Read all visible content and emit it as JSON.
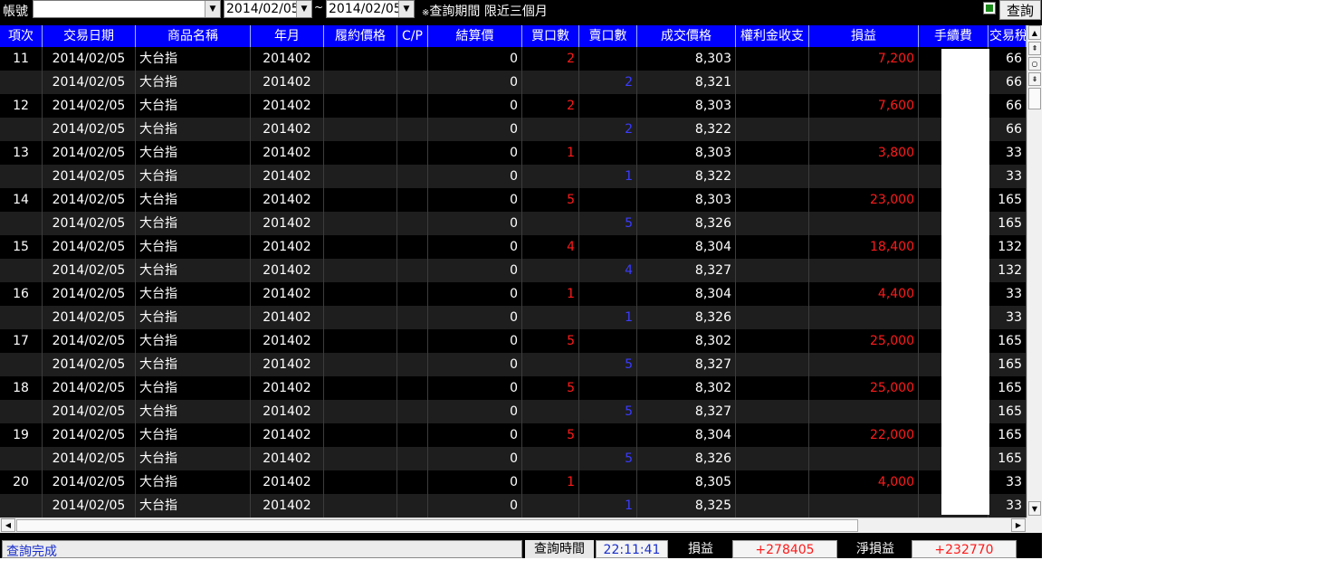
{
  "toolbar": {
    "account_label": "帳號",
    "account_value": "",
    "start_date": "2014/02/05",
    "end_date": "2014/02/05",
    "tilde": "~",
    "note_mark": "※",
    "note_text": "查詢期間 限近三個月",
    "query_label": "查詢"
  },
  "columns": [
    "項次",
    "交易日期",
    "商品名稱",
    "年月",
    "履約價格",
    "C/P",
    "結算價",
    "買口數",
    "賣口數",
    "成交價格",
    "權利金收支",
    "損益",
    "手續費",
    "交易稅"
  ],
  "rows": [
    {
      "no": "11",
      "date": "2014/02/05",
      "product": "大台指",
      "ym": "201402",
      "strike": "",
      "cp": "",
      "settle": "0",
      "buy": "2",
      "sell": "",
      "price": "8,303",
      "premium": "",
      "pnl": "7,200",
      "fee": "",
      "tax": "66"
    },
    {
      "no": "",
      "date": "2014/02/05",
      "product": "大台指",
      "ym": "201402",
      "strike": "",
      "cp": "",
      "settle": "0",
      "buy": "",
      "sell": "2",
      "price": "8,321",
      "premium": "",
      "pnl": "",
      "fee": "",
      "tax": "66"
    },
    {
      "no": "12",
      "date": "2014/02/05",
      "product": "大台指",
      "ym": "201402",
      "strike": "",
      "cp": "",
      "settle": "0",
      "buy": "2",
      "sell": "",
      "price": "8,303",
      "premium": "",
      "pnl": "7,600",
      "fee": "",
      "tax": "66"
    },
    {
      "no": "",
      "date": "2014/02/05",
      "product": "大台指",
      "ym": "201402",
      "strike": "",
      "cp": "",
      "settle": "0",
      "buy": "",
      "sell": "2",
      "price": "8,322",
      "premium": "",
      "pnl": "",
      "fee": "",
      "tax": "66"
    },
    {
      "no": "13",
      "date": "2014/02/05",
      "product": "大台指",
      "ym": "201402",
      "strike": "",
      "cp": "",
      "settle": "0",
      "buy": "1",
      "sell": "",
      "price": "8,303",
      "premium": "",
      "pnl": "3,800",
      "fee": "",
      "tax": "33"
    },
    {
      "no": "",
      "date": "2014/02/05",
      "product": "大台指",
      "ym": "201402",
      "strike": "",
      "cp": "",
      "settle": "0",
      "buy": "",
      "sell": "1",
      "price": "8,322",
      "premium": "",
      "pnl": "",
      "fee": "",
      "tax": "33"
    },
    {
      "no": "14",
      "date": "2014/02/05",
      "product": "大台指",
      "ym": "201402",
      "strike": "",
      "cp": "",
      "settle": "0",
      "buy": "5",
      "sell": "",
      "price": "8,303",
      "premium": "",
      "pnl": "23,000",
      "fee": "",
      "tax": "165"
    },
    {
      "no": "",
      "date": "2014/02/05",
      "product": "大台指",
      "ym": "201402",
      "strike": "",
      "cp": "",
      "settle": "0",
      "buy": "",
      "sell": "5",
      "price": "8,326",
      "premium": "",
      "pnl": "",
      "fee": "",
      "tax": "165"
    },
    {
      "no": "15",
      "date": "2014/02/05",
      "product": "大台指",
      "ym": "201402",
      "strike": "",
      "cp": "",
      "settle": "0",
      "buy": "4",
      "sell": "",
      "price": "8,304",
      "premium": "",
      "pnl": "18,400",
      "fee": "",
      "tax": "132"
    },
    {
      "no": "",
      "date": "2014/02/05",
      "product": "大台指",
      "ym": "201402",
      "strike": "",
      "cp": "",
      "settle": "0",
      "buy": "",
      "sell": "4",
      "price": "8,327",
      "premium": "",
      "pnl": "",
      "fee": "",
      "tax": "132"
    },
    {
      "no": "16",
      "date": "2014/02/05",
      "product": "大台指",
      "ym": "201402",
      "strike": "",
      "cp": "",
      "settle": "0",
      "buy": "1",
      "sell": "",
      "price": "8,304",
      "premium": "",
      "pnl": "4,400",
      "fee": "",
      "tax": "33"
    },
    {
      "no": "",
      "date": "2014/02/05",
      "product": "大台指",
      "ym": "201402",
      "strike": "",
      "cp": "",
      "settle": "0",
      "buy": "",
      "sell": "1",
      "price": "8,326",
      "premium": "",
      "pnl": "",
      "fee": "",
      "tax": "33"
    },
    {
      "no": "17",
      "date": "2014/02/05",
      "product": "大台指",
      "ym": "201402",
      "strike": "",
      "cp": "",
      "settle": "0",
      "buy": "5",
      "sell": "",
      "price": "8,302",
      "premium": "",
      "pnl": "25,000",
      "fee": "",
      "tax": "165"
    },
    {
      "no": "",
      "date": "2014/02/05",
      "product": "大台指",
      "ym": "201402",
      "strike": "",
      "cp": "",
      "settle": "0",
      "buy": "",
      "sell": "5",
      "price": "8,327",
      "premium": "",
      "pnl": "",
      "fee": "",
      "tax": "165"
    },
    {
      "no": "18",
      "date": "2014/02/05",
      "product": "大台指",
      "ym": "201402",
      "strike": "",
      "cp": "",
      "settle": "0",
      "buy": "5",
      "sell": "",
      "price": "8,302",
      "premium": "",
      "pnl": "25,000",
      "fee": "",
      "tax": "165"
    },
    {
      "no": "",
      "date": "2014/02/05",
      "product": "大台指",
      "ym": "201402",
      "strike": "",
      "cp": "",
      "settle": "0",
      "buy": "",
      "sell": "5",
      "price": "8,327",
      "premium": "",
      "pnl": "",
      "fee": "",
      "tax": "165"
    },
    {
      "no": "19",
      "date": "2014/02/05",
      "product": "大台指",
      "ym": "201402",
      "strike": "",
      "cp": "",
      "settle": "0",
      "buy": "5",
      "sell": "",
      "price": "8,304",
      "premium": "",
      "pnl": "22,000",
      "fee": "",
      "tax": "165"
    },
    {
      "no": "",
      "date": "2014/02/05",
      "product": "大台指",
      "ym": "201402",
      "strike": "",
      "cp": "",
      "settle": "0",
      "buy": "",
      "sell": "5",
      "price": "8,326",
      "premium": "",
      "pnl": "",
      "fee": "",
      "tax": "165"
    },
    {
      "no": "20",
      "date": "2014/02/05",
      "product": "大台指",
      "ym": "201402",
      "strike": "",
      "cp": "",
      "settle": "0",
      "buy": "1",
      "sell": "",
      "price": "8,305",
      "premium": "",
      "pnl": "4,000",
      "fee": "",
      "tax": "33"
    },
    {
      "no": "",
      "date": "2014/02/05",
      "product": "大台指",
      "ym": "201402",
      "strike": "",
      "cp": "",
      "settle": "0",
      "buy": "",
      "sell": "1",
      "price": "8,325",
      "premium": "",
      "pnl": "",
      "fee": "",
      "tax": "33"
    }
  ],
  "status": {
    "message": "查詢完成",
    "query_time_label": "查詢時間",
    "query_time": "22:11:41",
    "pnl_label": "損益",
    "pnl_value": "+278405",
    "net_pnl_label": "淨損益",
    "net_pnl_value": "+232770"
  },
  "colors": {
    "header_bg": "#0000ff",
    "buy_color": "#ff1a1a",
    "sell_color": "#3b3bff",
    "profit_color": "#ff1a1a",
    "status_text": "#1a2fcc"
  },
  "icons": {
    "dropdown": "chevron-down-icon",
    "export": "export-icon",
    "scroll_up": "arrow-up-icon",
    "scroll_down": "arrow-down-icon",
    "scroll_left": "arrow-left-icon",
    "scroll_right": "arrow-right-icon"
  }
}
